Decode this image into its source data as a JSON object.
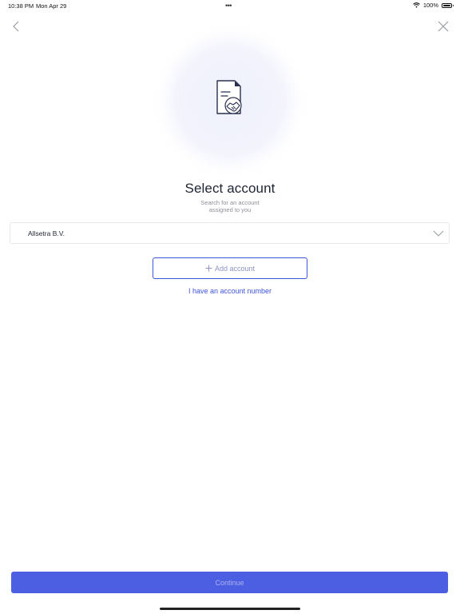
{
  "status_bar": {
    "time": "10:38 PM",
    "date": "Mon Apr 29",
    "battery": "100%",
    "wifi_icon": "wifi-icon",
    "battery_icon": "battery-icon"
  },
  "nav": {
    "back_icon": "chevron-left-icon",
    "close_icon": "close-icon"
  },
  "illustration": {
    "icon": "document-handshake-icon"
  },
  "header": {
    "title": "Select account",
    "subtitle": "Search for an account assigned to you"
  },
  "account_select": {
    "selected_value": "Allsetra B.V.",
    "chevron_icon": "chevron-down-icon"
  },
  "actions": {
    "add_account_label": "Add account",
    "add_icon": "plus-icon",
    "account_number_link": "I have an account number",
    "continue_label": "Continue"
  },
  "colors": {
    "primary": "#4c5fe2",
    "link": "#3f55d9",
    "muted_text": "#8d8f99"
  }
}
